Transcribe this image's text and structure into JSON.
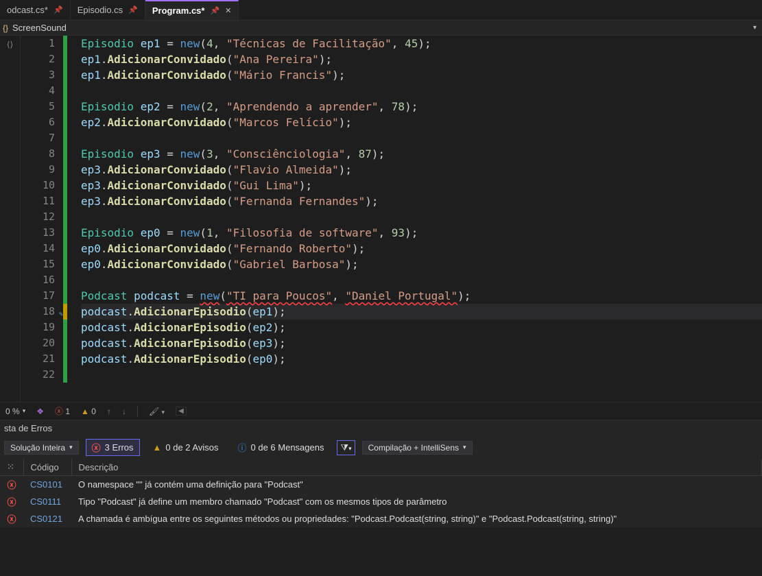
{
  "tabs": [
    {
      "label": "odcast.cs*",
      "pinned": true,
      "active": false
    },
    {
      "label": "Episodio.cs",
      "pinned": true,
      "active": false
    },
    {
      "label": "Program.cs*",
      "pinned": true,
      "active": true
    }
  ],
  "breadcrumb": {
    "namespace": "ScreenSound"
  },
  "code": {
    "lines": [
      {
        "n": 1,
        "change": "green",
        "tokens": [
          [
            "type",
            "Episodio"
          ],
          [
            "pun",
            " "
          ],
          [
            "var",
            "ep1"
          ],
          [
            "pun",
            " = "
          ],
          [
            "kw",
            "new"
          ],
          [
            "pun",
            "("
          ],
          [
            "num",
            "4"
          ],
          [
            "pun",
            ", "
          ],
          [
            "str",
            "\"Técnicas de Facilitação\""
          ],
          [
            "pun",
            ", "
          ],
          [
            "num",
            "45"
          ],
          [
            "pun",
            ");"
          ]
        ]
      },
      {
        "n": 2,
        "change": "green",
        "tokens": [
          [
            "var",
            "ep1"
          ],
          [
            "pun",
            "."
          ],
          [
            "fn",
            "AdicionarConvidado"
          ],
          [
            "pun",
            "("
          ],
          [
            "str",
            "\"Ana Pereira\""
          ],
          [
            "pun",
            ");"
          ]
        ]
      },
      {
        "n": 3,
        "change": "green",
        "tokens": [
          [
            "var",
            "ep1"
          ],
          [
            "pun",
            "."
          ],
          [
            "fn",
            "AdicionarConvidado"
          ],
          [
            "pun",
            "("
          ],
          [
            "str",
            "\"Mário Francis\""
          ],
          [
            "pun",
            ");"
          ]
        ]
      },
      {
        "n": 4,
        "change": "green",
        "tokens": []
      },
      {
        "n": 5,
        "change": "green",
        "tokens": [
          [
            "type",
            "Episodio"
          ],
          [
            "pun",
            " "
          ],
          [
            "var",
            "ep2"
          ],
          [
            "pun",
            " = "
          ],
          [
            "kw",
            "new"
          ],
          [
            "pun",
            "("
          ],
          [
            "num",
            "2"
          ],
          [
            "pun",
            ", "
          ],
          [
            "str",
            "\"Aprendendo a aprender\""
          ],
          [
            "pun",
            ", "
          ],
          [
            "num",
            "78"
          ],
          [
            "pun",
            ");"
          ]
        ]
      },
      {
        "n": 6,
        "change": "green",
        "tokens": [
          [
            "var",
            "ep2"
          ],
          [
            "pun",
            "."
          ],
          [
            "fn",
            "AdicionarConvidado"
          ],
          [
            "pun",
            "("
          ],
          [
            "str",
            "\"Marcos Felício\""
          ],
          [
            "pun",
            ");"
          ]
        ]
      },
      {
        "n": 7,
        "change": "green",
        "tokens": []
      },
      {
        "n": 8,
        "change": "green",
        "tokens": [
          [
            "type",
            "Episodio"
          ],
          [
            "pun",
            " "
          ],
          [
            "var",
            "ep3"
          ],
          [
            "pun",
            " = "
          ],
          [
            "kw",
            "new"
          ],
          [
            "pun",
            "("
          ],
          [
            "num",
            "3"
          ],
          [
            "pun",
            ", "
          ],
          [
            "str",
            "\"Consciênciologia\""
          ],
          [
            "pun",
            ", "
          ],
          [
            "num",
            "87"
          ],
          [
            "pun",
            ");"
          ]
        ]
      },
      {
        "n": 9,
        "change": "green",
        "tokens": [
          [
            "var",
            "ep3"
          ],
          [
            "pun",
            "."
          ],
          [
            "fn",
            "AdicionarConvidado"
          ],
          [
            "pun",
            "("
          ],
          [
            "str",
            "\"Flavio Almeida\""
          ],
          [
            "pun",
            ");"
          ]
        ]
      },
      {
        "n": 10,
        "change": "green",
        "tokens": [
          [
            "var",
            "ep3"
          ],
          [
            "pun",
            "."
          ],
          [
            "fn",
            "AdicionarConvidado"
          ],
          [
            "pun",
            "("
          ],
          [
            "str",
            "\"Gui Lima\""
          ],
          [
            "pun",
            ");"
          ]
        ]
      },
      {
        "n": 11,
        "change": "green",
        "tokens": [
          [
            "var",
            "ep3"
          ],
          [
            "pun",
            "."
          ],
          [
            "fn",
            "AdicionarConvidado"
          ],
          [
            "pun",
            "("
          ],
          [
            "str",
            "\"Fernanda Fernandes\""
          ],
          [
            "pun",
            ");"
          ]
        ]
      },
      {
        "n": 12,
        "change": "green",
        "tokens": []
      },
      {
        "n": 13,
        "change": "green",
        "tokens": [
          [
            "type",
            "Episodio"
          ],
          [
            "pun",
            " "
          ],
          [
            "var",
            "ep0"
          ],
          [
            "pun",
            " = "
          ],
          [
            "kw",
            "new"
          ],
          [
            "pun",
            "("
          ],
          [
            "num",
            "1"
          ],
          [
            "pun",
            ", "
          ],
          [
            "str",
            "\"Filosofia de software\""
          ],
          [
            "pun",
            ", "
          ],
          [
            "num",
            "93"
          ],
          [
            "pun",
            ");"
          ]
        ]
      },
      {
        "n": 14,
        "change": "green",
        "tokens": [
          [
            "var",
            "ep0"
          ],
          [
            "pun",
            "."
          ],
          [
            "fn",
            "AdicionarConvidado"
          ],
          [
            "pun",
            "("
          ],
          [
            "str",
            "\"Fernando Roberto\""
          ],
          [
            "pun",
            ");"
          ]
        ]
      },
      {
        "n": 15,
        "change": "green",
        "tokens": [
          [
            "var",
            "ep0"
          ],
          [
            "pun",
            "."
          ],
          [
            "fn",
            "AdicionarConvidado"
          ],
          [
            "pun",
            "("
          ],
          [
            "str",
            "\"Gabriel Barbosa\""
          ],
          [
            "pun",
            ");"
          ]
        ]
      },
      {
        "n": 16,
        "change": "green",
        "tokens": []
      },
      {
        "n": 17,
        "change": "green",
        "err": true,
        "tokens": [
          [
            "type",
            "Podcast"
          ],
          [
            "pun",
            " "
          ],
          [
            "var",
            "podcast"
          ],
          [
            "pun",
            " = "
          ],
          [
            "kw",
            "new"
          ],
          [
            "pun",
            "("
          ],
          [
            "str",
            "\"TI para Poucos\""
          ],
          [
            "pun",
            ", "
          ],
          [
            "str",
            "\"Daniel Portugal\""
          ],
          [
            "pun",
            ");"
          ]
        ]
      },
      {
        "n": 18,
        "change": "yellow",
        "hl": true,
        "refmark": true,
        "tokens": [
          [
            "var",
            "podcast"
          ],
          [
            "pun",
            "."
          ],
          [
            "fn",
            "AdicionarEpisodio"
          ],
          [
            "pun",
            "("
          ],
          [
            "var",
            "ep1"
          ],
          [
            "pun",
            ");"
          ]
        ]
      },
      {
        "n": 19,
        "change": "green",
        "tokens": [
          [
            "var",
            "podcast"
          ],
          [
            "pun",
            "."
          ],
          [
            "fn",
            "AdicionarEpisodio"
          ],
          [
            "pun",
            "("
          ],
          [
            "var",
            "ep2"
          ],
          [
            "pun",
            ");"
          ]
        ]
      },
      {
        "n": 20,
        "change": "green",
        "tokens": [
          [
            "var",
            "podcast"
          ],
          [
            "pun",
            "."
          ],
          [
            "fn",
            "AdicionarEpisodio"
          ],
          [
            "pun",
            "("
          ],
          [
            "var",
            "ep3"
          ],
          [
            "pun",
            ");"
          ]
        ]
      },
      {
        "n": 21,
        "change": "green",
        "tokens": [
          [
            "var",
            "podcast"
          ],
          [
            "pun",
            "."
          ],
          [
            "fn",
            "AdicionarEpisodio"
          ],
          [
            "pun",
            "("
          ],
          [
            "var",
            "ep0"
          ],
          [
            "pun",
            ");"
          ]
        ]
      },
      {
        "n": 22,
        "change": "green",
        "tokens": []
      }
    ]
  },
  "status": {
    "percent": "0 %",
    "errors": "1",
    "warnings": "0"
  },
  "errorlist": {
    "title": "sta de Erros",
    "scope": "Solução Inteira",
    "filters": {
      "errors": "3 Erros",
      "warnings": "0 de 2 Avisos",
      "messages": "0 de 6 Mensagens"
    },
    "build_combo": "Compilação + IntelliSens",
    "headers": {
      "code": "Código",
      "desc": "Descrição"
    },
    "rows": [
      {
        "code": "CS0101",
        "desc": "O namespace \"<global namespace>\" já contém uma definição para \"Podcast\""
      },
      {
        "code": "CS0111",
        "desc": "Tipo \"Podcast\" já define um membro chamado \"Podcast\" com os mesmos tipos de parâmetro"
      },
      {
        "code": "CS0121",
        "desc": "A chamada é ambígua entre os seguintes métodos ou propriedades: \"Podcast.Podcast(string, string)\" e \"Podcast.Podcast(string, string)\""
      }
    ]
  }
}
